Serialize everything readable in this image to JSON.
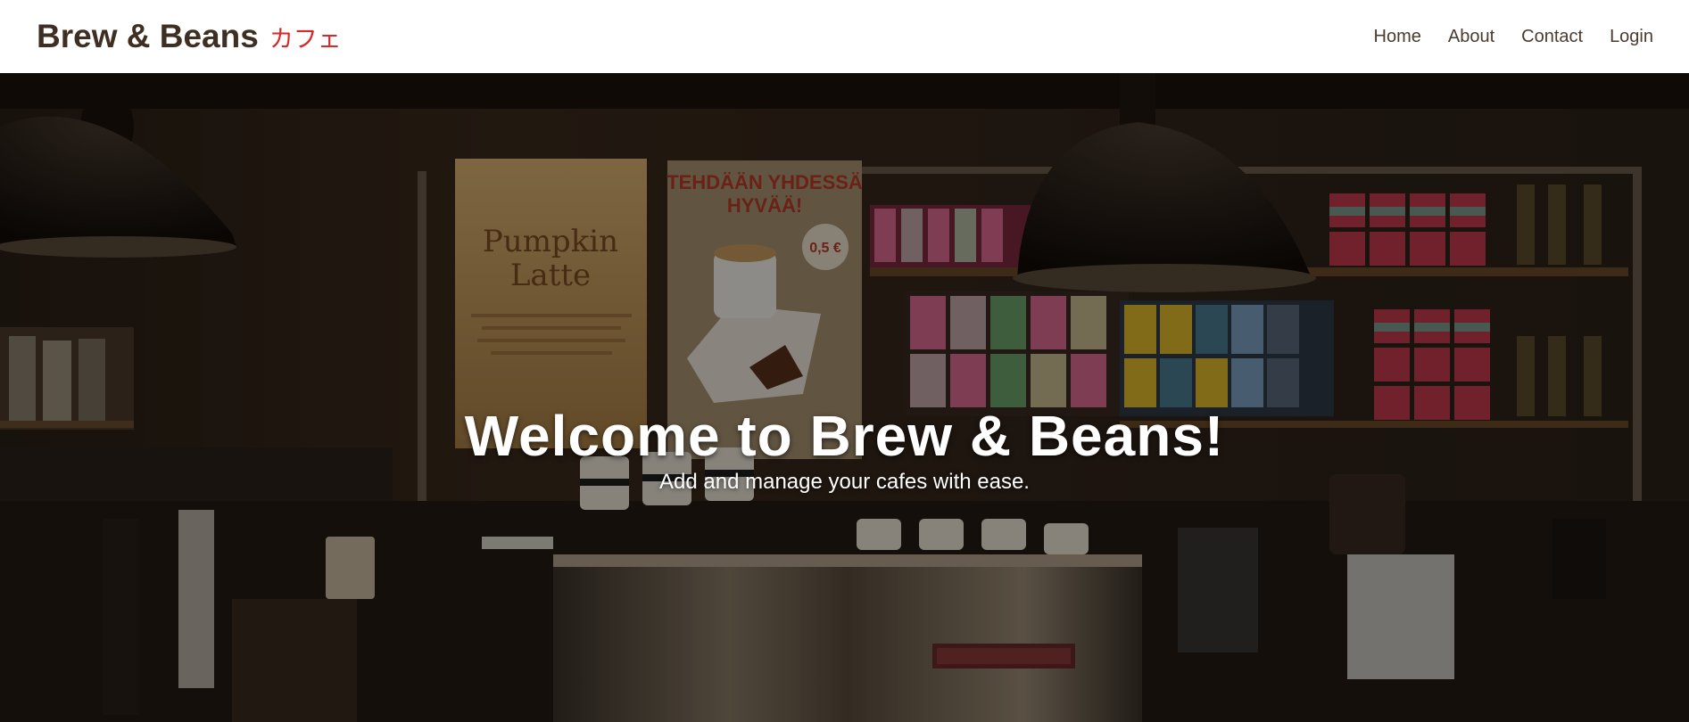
{
  "brand": {
    "name": "Brew & Beans",
    "sub": "カフェ"
  },
  "nav": {
    "items": [
      {
        "label": "Home"
      },
      {
        "label": "About"
      },
      {
        "label": "Contact"
      },
      {
        "label": "Login"
      }
    ]
  },
  "hero": {
    "title": "Welcome to Brew & Beans!",
    "subtitle": "Add and manage your cafes with ease.",
    "background_image": "coffee-shop-counter-photo",
    "posters": {
      "left_title_line1": "Pumpkin",
      "left_title_line2": "Latte",
      "right_heading_line1": "TEHDÄÄN YHDESSÄ",
      "right_heading_line2": "HYVÄÄ!",
      "price": "0,5 €"
    }
  },
  "colors": {
    "brand_text": "#3e2f22",
    "brand_accent": "#d42a2a",
    "nav_text": "#4a3b2f",
    "hero_text": "#ffffff"
  }
}
